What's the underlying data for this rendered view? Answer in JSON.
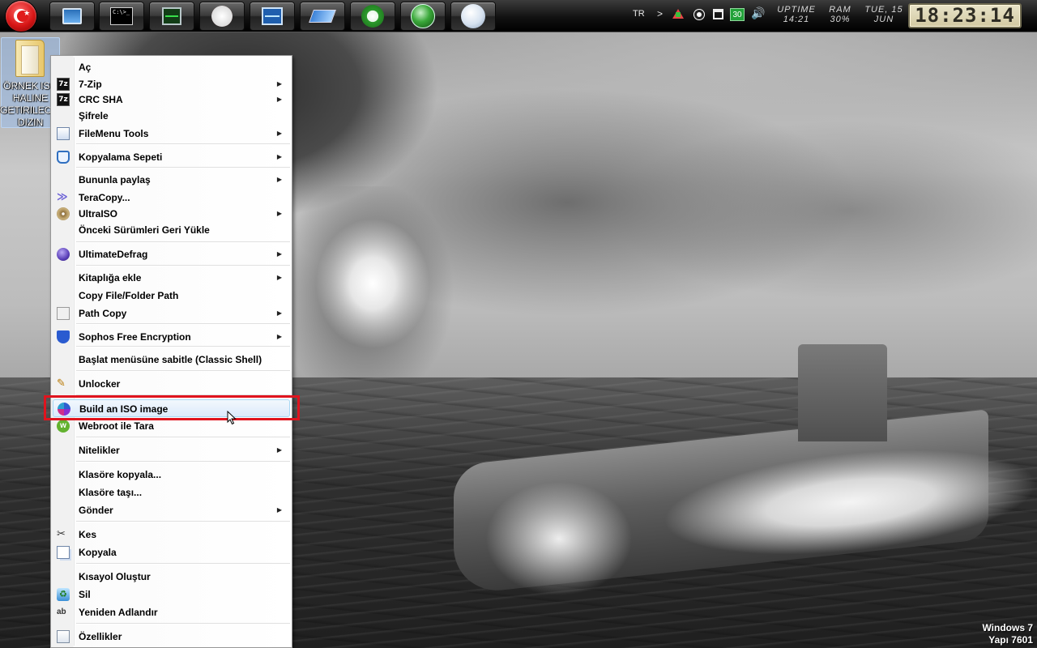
{
  "dock": {
    "items": [
      {
        "icon": "computer-icon"
      },
      {
        "icon": "command-prompt-icon",
        "text": "C:\\>_"
      },
      {
        "icon": "task-manager-icon"
      },
      {
        "icon": "compass-icon"
      },
      {
        "icon": "performance-monitor-icon"
      },
      {
        "icon": "windows-flag-icon"
      },
      {
        "icon": "key-icon"
      },
      {
        "icon": "globe-icon"
      },
      {
        "icon": "moon-icon"
      }
    ]
  },
  "tray": {
    "language": "TR",
    "arrow": ">",
    "network_badge": "30",
    "volume_glyph": "🔊"
  },
  "gauges": {
    "uptime_label": "UPTIME",
    "uptime_value": "14:21",
    "ram_label": "RAM",
    "ram_value": "30%",
    "date_line1": "TUE, 15",
    "date_line2": "JUN"
  },
  "clock": "18:23:14",
  "desktop_icon": {
    "label": "ÖRNEK ISO\nHALINE\nGETIRILECEK\nDIZIN"
  },
  "context_menu": {
    "items": [
      {
        "label": "Aç",
        "submenu": false
      },
      {
        "label": "7-Zip",
        "submenu": true,
        "icon": "7zip-icon"
      },
      {
        "label": "CRC SHA",
        "submenu": true,
        "icon": "7zip-icon"
      },
      {
        "label": "Şifrele",
        "submenu": false
      },
      {
        "label": "FileMenu Tools",
        "submenu": true,
        "icon": "documents-icon"
      },
      {
        "label": "Kopyalama Sepeti",
        "submenu": true,
        "icon": "basket-icon"
      },
      {
        "label": "Bununla paylaş",
        "submenu": true
      },
      {
        "label": "TeraCopy...",
        "submenu": false,
        "icon": "teracopy-icon"
      },
      {
        "label": "UltraISO",
        "submenu": true,
        "icon": "disc-icon"
      },
      {
        "label": "Önceki Sürümleri Geri Yükle",
        "submenu": false
      },
      {
        "label": "UltimateDefrag",
        "submenu": true,
        "icon": "defrag-icon"
      },
      {
        "label": "Kitaplığa ekle",
        "submenu": true
      },
      {
        "label": "Copy File/Folder Path",
        "submenu": false
      },
      {
        "label": "Path Copy",
        "submenu": true,
        "icon": "path-copy-icon"
      },
      {
        "label": "Sophos Free Encryption",
        "submenu": true,
        "icon": "shield-icon"
      },
      {
        "label": "Başlat menüsüne sabitle (Classic Shell)",
        "submenu": false
      },
      {
        "label": "Unlocker",
        "submenu": false,
        "icon": "wand-icon"
      },
      {
        "label": "Build an ISO image",
        "submenu": false,
        "icon": "iso-icon",
        "highlighted": true
      },
      {
        "label": "Webroot ile Tara",
        "submenu": false,
        "icon": "webroot-icon"
      },
      {
        "label": "Nitelikler",
        "submenu": true
      },
      {
        "label": "Klasöre kopyala...",
        "submenu": false
      },
      {
        "label": "Klasöre taşı...",
        "submenu": false
      },
      {
        "label": "Gönder",
        "submenu": true
      },
      {
        "label": "Kes",
        "submenu": false,
        "icon": "scissors-icon"
      },
      {
        "label": "Kopyala",
        "submenu": false,
        "icon": "copy-icon"
      },
      {
        "label": "Kısayol Oluştur",
        "submenu": false
      },
      {
        "label": "Sil",
        "submenu": false,
        "icon": "recycle-icon"
      },
      {
        "label": "Yeniden Adlandır",
        "submenu": false,
        "icon": "rename-icon"
      },
      {
        "label": "Özellikler",
        "submenu": false,
        "icon": "properties-icon"
      }
    ],
    "submenu_glyph": "▶"
  },
  "annotation": {
    "color": "#e0141e"
  },
  "watermark": {
    "line1": "Windows 7",
    "line2": "Yapı 7601"
  },
  "colors": {
    "menu_highlight": "#dceafb",
    "start_orb": "#d71616",
    "clock_face": "#d2c9a2"
  }
}
